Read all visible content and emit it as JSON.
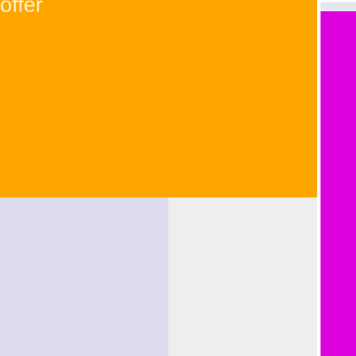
{
  "colors": {
    "page_background": "#ffffff",
    "offer_tile": "#ffa500",
    "offer_text": "#fff3d6",
    "lavender_tile": "#dcdcec",
    "gray_tile": "#eeeeee",
    "top_strip": "#e6e6f0",
    "magenta_bar": "#dc00dc"
  },
  "tiles": {
    "offer": {
      "label": "offer"
    }
  }
}
